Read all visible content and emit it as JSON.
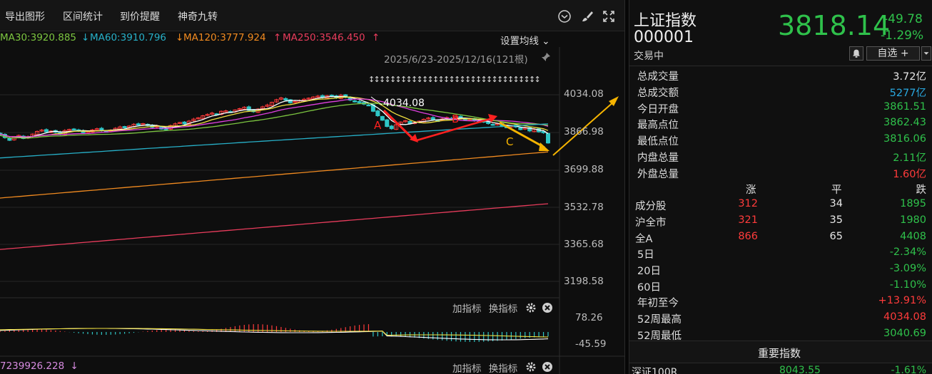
{
  "toolbar": {
    "export_chart": "导出图形",
    "range_stats": "区间统计",
    "price_alert": "到价提醒",
    "magic_nine": "神奇九转"
  },
  "ma_line": {
    "ma30": "MA30:3920.885",
    "ma60_arrow": "↓",
    "ma60": "MA60:3910.796",
    "ma120_arrow": "↓",
    "ma120": "MA120:3777.924",
    "ma250_arrow": "↑",
    "ma250": "MA250:3546.450",
    "ma250_end_arrow": "↑",
    "set_ma": "设置均线",
    "set_ma_caret": "⌄"
  },
  "chart": {
    "range_label": "2025/6/23-2025/12/16(121根)",
    "peak_label": "4034.08",
    "wave_a": "A",
    "wave_b": "B",
    "wave_c": "C",
    "y_ticks": [
      "4034.08",
      "3866.98",
      "3699.88",
      "3532.78",
      "3365.68",
      "3198.58"
    ],
    "colors": {
      "up": "#ff3b3b",
      "down": "#2fc6c6",
      "ma5": "#ffffff",
      "ma10": "#f0e040",
      "ma20": "#e040e0",
      "ma30": "#7cc540",
      "ma60": "#27b0c8",
      "ma120": "#f08a20",
      "ma250": "#e83c5c",
      "arrow_red": "#ff2020",
      "arrow_yellow": "#f6b400"
    }
  },
  "sub_chart": {
    "add_indicator": "加指标",
    "switch_indicator": "换指标",
    "y_top": "78.26",
    "y_bottom": "-45.59"
  },
  "bottom_panel": {
    "value": "7239926.228",
    "arrow": "↓",
    "add_indicator": "加指标",
    "switch_indicator": "换指标"
  },
  "quote": {
    "name": "上证指数",
    "code": "000001",
    "status": "交易中",
    "price": "3818.14",
    "change": "-49.78",
    "change_pct": "-1.29%",
    "watchlist_btn": "自选 +"
  },
  "stats": [
    {
      "label": "总成交量",
      "value": "3.72亿",
      "color": "white"
    },
    {
      "label": "总成交额",
      "value": "5277亿",
      "color": "blue"
    },
    {
      "label": "今日开盘",
      "value": "3861.51",
      "color": "green"
    },
    {
      "label": "最高点位",
      "value": "3862.43",
      "color": "green"
    },
    {
      "label": "最低点位",
      "value": "3816.06",
      "color": "green"
    },
    {
      "label": "内盘总量",
      "value": "2.11亿",
      "color": "green"
    },
    {
      "label": "外盘总量",
      "value": "1.60亿",
      "color": "red"
    }
  ],
  "breadth": {
    "headers": [
      "涨",
      "平",
      "跌"
    ],
    "rows": [
      {
        "label": "成分股",
        "up": "312",
        "flat": "34",
        "down": "1895"
      },
      {
        "label": "沪全市",
        "up": "321",
        "flat": "35",
        "down": "1980"
      },
      {
        "label": "全A",
        "up": "866",
        "flat": "65",
        "down": "4408"
      }
    ]
  },
  "periods": [
    {
      "label": "5日",
      "value": "-2.34%",
      "color": "green"
    },
    {
      "label": "20日",
      "value": "-3.09%",
      "color": "green"
    },
    {
      "label": "60日",
      "value": "-1.10%",
      "color": "green"
    },
    {
      "label": "年初至今",
      "value": "+13.91%",
      "color": "red"
    },
    {
      "label": "52周最高",
      "value": "4034.08",
      "color": "red"
    },
    {
      "label": "52周最低",
      "value": "3040.69",
      "color": "green"
    }
  ],
  "major_index": {
    "title": "重要指数",
    "row": {
      "name": "深证100R",
      "price": "8043.55",
      "pct": "-1.61%"
    }
  }
}
